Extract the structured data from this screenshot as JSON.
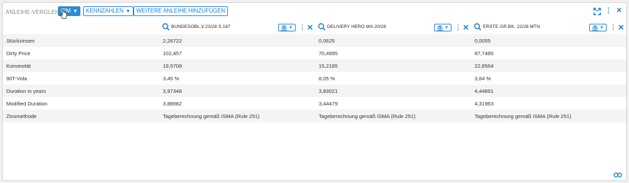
{
  "toolbar": {
    "title": "ANLEIHE-VERGLEICH",
    "view_label": "IPM",
    "kennzahlen_label": "KENNZAHLEN",
    "add_label": "WEITERE ANLEIHE HINZUFÜGEN"
  },
  "columns": [
    {
      "name": "BUNDESOBL.V.23/28 S.187"
    },
    {
      "name": "DELIVERY HERO WA 20/28"
    },
    {
      "name": "ERSTE GR.BK. 22/28 MTN"
    }
  ],
  "rows": [
    {
      "label": "Stückzinsen",
      "values": [
        "2,26722",
        "0,0625",
        "0,0055"
      ]
    },
    {
      "label": "Dirty Price",
      "values": [
        "102,457",
        "70,4995",
        "87,7485"
      ]
    },
    {
      "label": "Konvexität",
      "values": [
        "19,5708",
        "15,2185",
        "22,8564"
      ]
    },
    {
      "label": "90T-Vola",
      "values": [
        "3,45 %",
        "8,05 %",
        "3,64 %"
      ]
    },
    {
      "label": "Duration in years",
      "values": [
        "3,97348",
        "3,83021",
        "4,44891"
      ]
    },
    {
      "label": "Modified Duration",
      "values": [
        "3,88982",
        "3,44479",
        "4,31963"
      ]
    },
    {
      "label": "Zinsmethode",
      "values": [
        "Tageberechnung gemäß ISMA (Rule 251)",
        "Tageberechnung gemäß ISMA (Rule 251)",
        "Tageberechnung gemäß ISMA (Rule 251)"
      ]
    }
  ],
  "icons": {
    "expand": "expand-icon",
    "menu": "kebab-menu-icon",
    "close": "close-icon",
    "search": "search-icon",
    "bank": "bank-icon",
    "link": "link-icon"
  },
  "colors": {
    "accent": "#2d8ccd",
    "text": "#333333",
    "muted": "#8a8a8a",
    "row_alt": "#f4f4f4"
  }
}
